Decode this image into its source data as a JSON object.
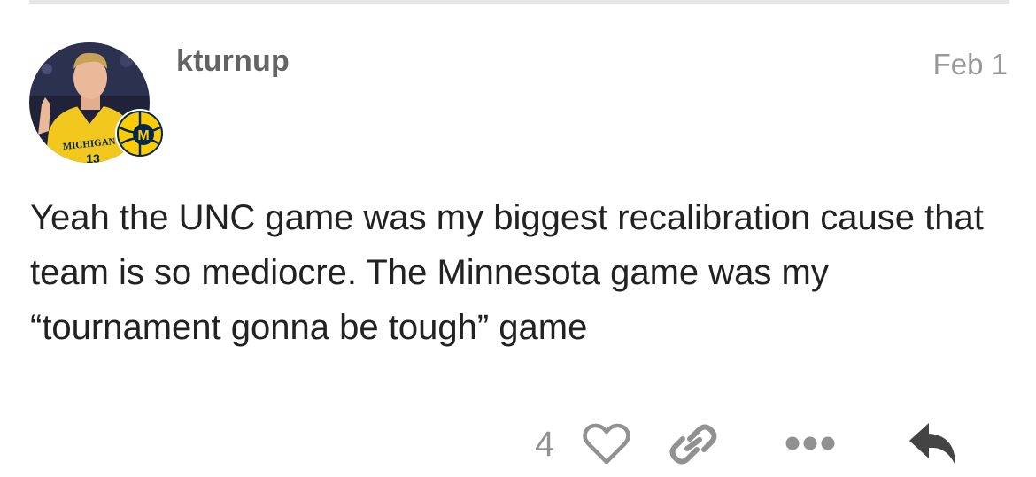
{
  "post": {
    "username": "kturnup",
    "date": "Feb 1",
    "body": "Yeah the UNC game was my biggest recalibration cause that team is so mediocre. The Minnesota game was my “tournament gonna be tough” game",
    "avatar": {
      "jersey_text": "MICHIGAN",
      "jersey_number": "13",
      "flair_letter": "M"
    }
  },
  "actions": {
    "like_count": "4",
    "icons": [
      "heart-icon",
      "link-icon",
      "more-icon",
      "reply-icon"
    ]
  },
  "colors": {
    "username": "#646464",
    "date": "#999999",
    "body": "#222222",
    "action_icons": "#919191",
    "maize": "#ffcb05",
    "navy": "#00274c"
  }
}
